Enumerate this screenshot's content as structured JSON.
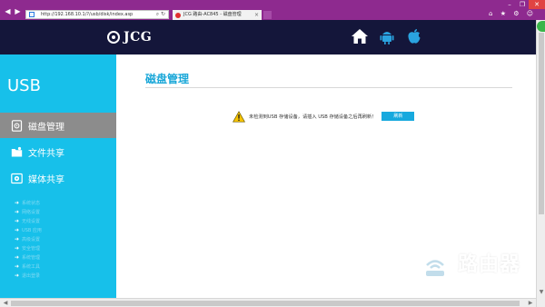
{
  "browser": {
    "address": "http://192.168.10.1/?/usb/disk/index.asp",
    "tab_title": "JCG 路由-AC845 - 磁盘管理",
    "tab_close": "×",
    "window_buttons": [
      "–",
      "❐",
      "✕"
    ],
    "right_icons": "⌂ ★ ⚙ ☺"
  },
  "header": {
    "logo_text": "JCG",
    "icons": [
      "home-icon",
      "android-icon",
      "apple-icon"
    ]
  },
  "sidebar": {
    "title": "USB",
    "items": [
      {
        "label": "磁盘管理",
        "icon": "disk-icon",
        "active": true
      },
      {
        "label": "文件共享",
        "icon": "folder-share-icon",
        "active": false
      },
      {
        "label": "媒体共享",
        "icon": "media-share-icon",
        "active": false
      }
    ],
    "sub_items": [
      "系统状态",
      "网络设置",
      "无线设置",
      "USB 应用",
      "高级设置",
      "安全管理",
      "系统管理",
      "系统工具",
      "退出登录"
    ]
  },
  "main": {
    "title": "磁盘管理",
    "warning_text": "未检测到USB 存储设备，请插入 USB 存储设备之后再刷新！",
    "refresh_label": "刷新"
  },
  "watermark": {
    "cn": "路由器",
    "en": "luyouqi.com"
  },
  "colors": {
    "chrome": "#8e2a8f",
    "header": "#14163a",
    "sidebar": "#17c0ea",
    "active_item": "#8c8c8c",
    "accent": "#1aa7d8"
  }
}
